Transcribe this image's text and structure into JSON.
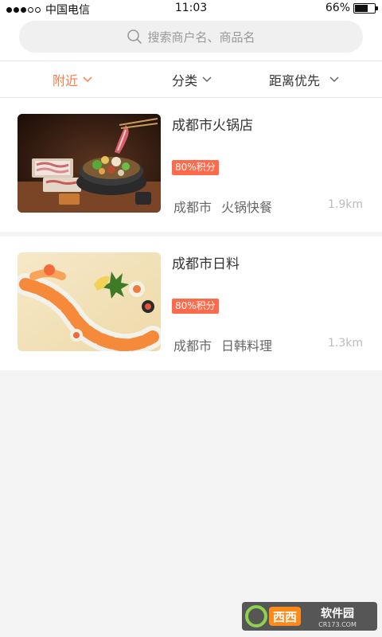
{
  "status_bar": {
    "carrier": "中国电信",
    "time": "11:03",
    "battery": "66%",
    "battery_level": 0.66
  },
  "search": {
    "placeholder": "搜索商户名、商品名"
  },
  "filters": [
    {
      "label": "附近",
      "active": true
    },
    {
      "label": "分类",
      "active": false
    },
    {
      "label": "距离优先",
      "active": false
    }
  ],
  "shops": [
    {
      "name": "成都市火锅店",
      "badge": "80%积分",
      "city": "成都市",
      "category": "火锅快餐",
      "distance": "1.9km",
      "image": "hotpot"
    },
    {
      "name": "成都市日料",
      "badge": "80%积分",
      "city": "成都市",
      "category": "日韩料理",
      "distance": "1.3km",
      "image": "sushi"
    }
  ],
  "watermark": {
    "brand": "西西",
    "text": "软件园",
    "site": "CR173.COM"
  },
  "colors": {
    "accent": "#ff7a45",
    "badge": "#ff6b4a"
  }
}
